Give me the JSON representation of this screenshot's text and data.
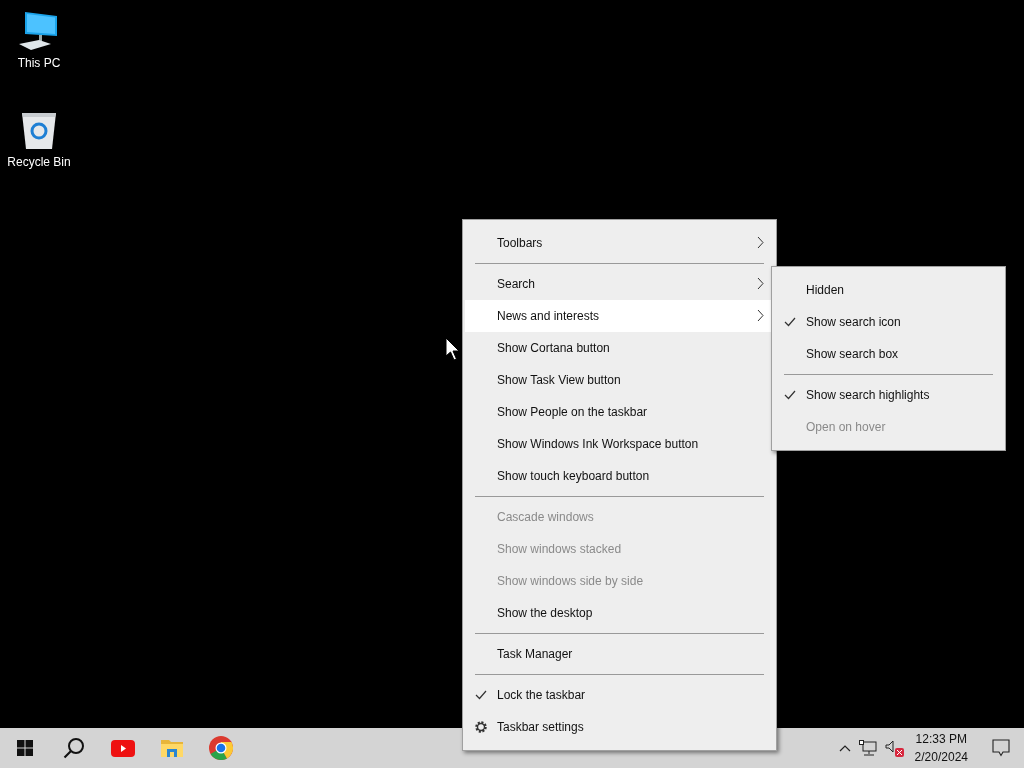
{
  "desktop_icons": [
    {
      "kind": "computer",
      "label": "This PC"
    },
    {
      "kind": "recycle-bin",
      "label": "Recycle Bin"
    }
  ],
  "context_menu": {
    "items": [
      {
        "kind": "item",
        "label": "Toolbars",
        "submenu": true,
        "selected": false,
        "checked": false,
        "disabled": false
      },
      {
        "kind": "separator"
      },
      {
        "kind": "item",
        "label": "Search",
        "submenu": true,
        "selected": false,
        "checked": false,
        "disabled": false
      },
      {
        "kind": "item",
        "label": "News and interests",
        "submenu": true,
        "selected": true,
        "checked": false,
        "disabled": false
      },
      {
        "kind": "item",
        "label": "Show Cortana button",
        "submenu": false,
        "selected": false,
        "checked": false,
        "disabled": false
      },
      {
        "kind": "item",
        "label": "Show Task View button",
        "submenu": false,
        "selected": false,
        "checked": false,
        "disabled": false
      },
      {
        "kind": "item",
        "label": "Show People on the taskbar",
        "submenu": false,
        "selected": false,
        "checked": false,
        "disabled": false
      },
      {
        "kind": "item",
        "label": "Show Windows Ink Workspace button",
        "submenu": false,
        "selected": false,
        "checked": false,
        "disabled": false
      },
      {
        "kind": "item",
        "label": "Show touch keyboard button",
        "submenu": false,
        "selected": false,
        "checked": false,
        "disabled": false
      },
      {
        "kind": "separator"
      },
      {
        "kind": "item",
        "label": "Cascade windows",
        "submenu": false,
        "selected": false,
        "checked": false,
        "disabled": true
      },
      {
        "kind": "item",
        "label": "Show windows stacked",
        "submenu": false,
        "selected": false,
        "checked": false,
        "disabled": true
      },
      {
        "kind": "item",
        "label": "Show windows side by side",
        "submenu": false,
        "selected": false,
        "checked": false,
        "disabled": true
      },
      {
        "kind": "item",
        "label": "Show the desktop",
        "submenu": false,
        "selected": false,
        "checked": false,
        "disabled": false
      },
      {
        "kind": "separator"
      },
      {
        "kind": "item",
        "label": "Task Manager",
        "submenu": false,
        "selected": false,
        "checked": false,
        "disabled": false
      },
      {
        "kind": "separator"
      },
      {
        "kind": "item",
        "label": "Lock the taskbar",
        "submenu": false,
        "selected": false,
        "checked": true,
        "disabled": false
      },
      {
        "kind": "settings",
        "label": "Taskbar settings",
        "submenu": false,
        "selected": false,
        "checked": false,
        "disabled": false
      }
    ]
  },
  "submenu": {
    "items": [
      {
        "kind": "item",
        "label": "Hidden",
        "selected": false,
        "checked": false,
        "disabled": false
      },
      {
        "kind": "item",
        "label": "Show search icon",
        "selected": false,
        "checked": true,
        "disabled": false
      },
      {
        "kind": "item",
        "label": "Show search box",
        "selected": false,
        "checked": false,
        "disabled": false
      },
      {
        "kind": "separator"
      },
      {
        "kind": "item",
        "label": "Show search highlights",
        "selected": false,
        "checked": true,
        "disabled": false
      },
      {
        "kind": "item",
        "label": "Open on hover",
        "selected": false,
        "checked": false,
        "disabled": true
      }
    ]
  },
  "taskbar": {
    "apps": [
      {
        "kind": "start"
      },
      {
        "kind": "search"
      },
      {
        "kind": "youtube"
      },
      {
        "kind": "folder"
      },
      {
        "kind": "chrome"
      }
    ],
    "clock": {
      "time": "12:33 PM",
      "date": "2/20/2024"
    }
  }
}
